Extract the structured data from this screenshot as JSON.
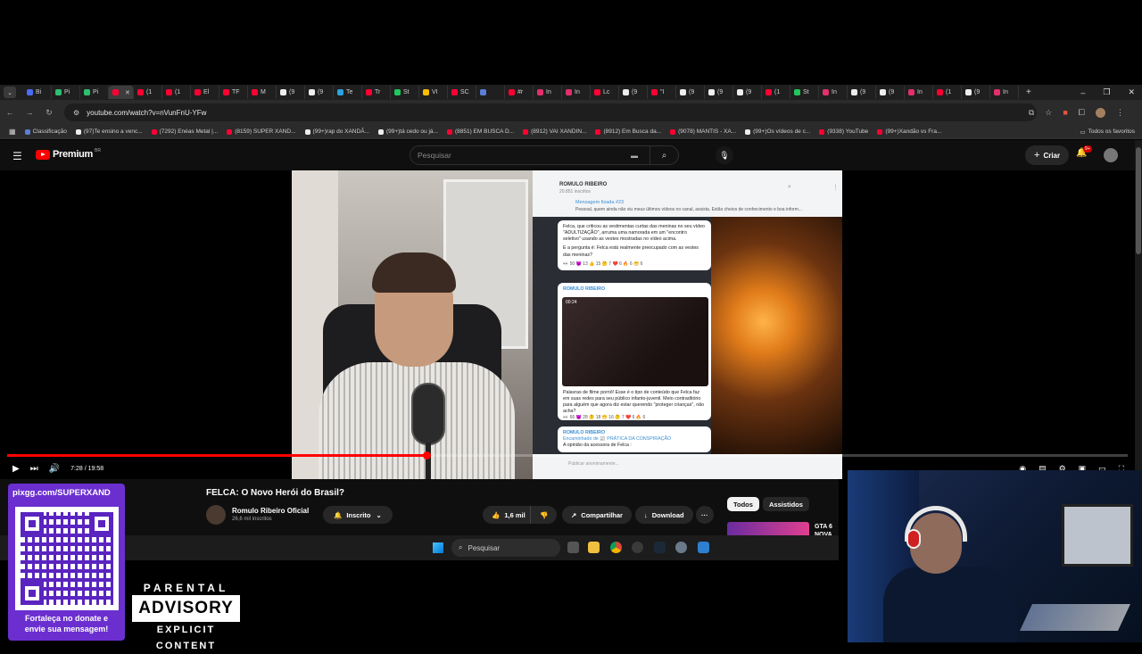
{
  "browser": {
    "tabs": [
      "Bi",
      "Pi",
      "Pi",
      "",
      "(1",
      "(1",
      "El",
      "TF",
      "M",
      "(9",
      "(9",
      "Te",
      "Tr",
      "St",
      "VI",
      "SC",
      "",
      "#r",
      "In",
      "In",
      "Lc",
      "(9",
      "\"I",
      "(9",
      "(9",
      "(9",
      "(1",
      "St",
      "In",
      "(9",
      "(9",
      "In",
      "(1",
      "(9",
      "In"
    ],
    "new_tab_label": "+",
    "window_controls": [
      "–",
      "❐",
      "✕"
    ],
    "url": "youtube.com/watch?v=nVunFnU-YFw",
    "bookmarks": [
      "Classificação",
      "(97)Te ensino a venc...",
      "(7292) Enéas Metal |...",
      "(8159) SUPER XAND...",
      "(99+)rap do XANDÃ...",
      "(99+)tá cedo ou já...",
      "(8851) EM BUSCA D...",
      "(8912) VAI XANDIN...",
      "(8912) Em Busca da...",
      "(9078) MANTIS - XA...",
      "(99+)Os vídeos de c...",
      "(9338) YouTube",
      "(99+)Xandão vs Fra..."
    ],
    "all_bookmarks": "Todos os favoritos"
  },
  "youtube": {
    "brand": "Premium",
    "region": "BR",
    "search_placeholder": "Pesquisar",
    "create_label": "Criar",
    "notif_badge": "9+"
  },
  "player": {
    "time": "7:28 / 19:58",
    "progress": 0.374
  },
  "telegram": {
    "channel": "ROMULO RIBEIRO",
    "subscribers": "20.851 inscritos",
    "pinned_title": "Mensagem fixada #23",
    "pinned_text": "Pessoal, quem ainda não viu meus últimos vídeos no canal, assista. Estão cheios de conhecimento e boa inform...",
    "msg1": "Felca, que criticou as vestimentas curtas das meninas no seu vídeo \"ADULTIZAÇÃO\", arruma uma namorada em um \"encontro seletivo\" usando as vestes mostradas no vídeo acima.",
    "msg1b": "E a pergunta é: Felca está realmente preocupado com as vestes das meninas?",
    "msg1_reactions": "👀 50  😈 13  👍 15  🤔 7  ❤️ 6  🔥 6  😁 6",
    "msg2_sender": "ROMULO RIBEIRO",
    "msg2_duration": "00:24",
    "msg2": "Palavras de filme pornô! Esse é o tipo de conteúdo que Felca faz em suas redes para seu público infanto-juvenil. Meio contraditório para alguém que agora diz estar querendo \"proteger crianças\", não acha?",
    "msg2_reactions": "👀 66  😈 28  🤔 18  😁 16  🤔 7  ❤️ 6  🔥 6",
    "msg3_sender": "ROMULO RIBEIRO",
    "msg3_forward": "Encaminhado de 📰 PRÁTICA DA CONSPIRAÇÃO",
    "msg3_text": "A opinião da acessora de Felca :",
    "input_placeholder": "Publicar anonimamente..."
  },
  "video": {
    "title": "FELCA: O Novo Herói do Brasil?",
    "channel": "Romulo Ribeiro Oficial",
    "subscribers": "26,6 mil inscritos",
    "subscribe_label": "Inscrito",
    "likes": "1,6 mil",
    "share_label": "Compartilhar",
    "download_label": "Download",
    "more_label": "···",
    "chips": [
      "Todos",
      "Assistidos"
    ],
    "rec_title": "GTA 6 NOVA"
  },
  "taskbar": {
    "search_placeholder": "Pesquisar"
  },
  "overlay": {
    "qr_url": "pixgg.com/SUPERXAND",
    "qr_caption_1": "Fortaleça no donate e",
    "qr_caption_2": "envie sua mensagem!",
    "pa_top": "PARENTAL",
    "pa_mid": "ADVISORY",
    "pa_bot": "EXPLICIT CONTENT"
  },
  "colors": {
    "youtube_red": "#ff0000",
    "qr_purple": "#6b2fd0",
    "telegram_blue": "#3b8fd4"
  }
}
